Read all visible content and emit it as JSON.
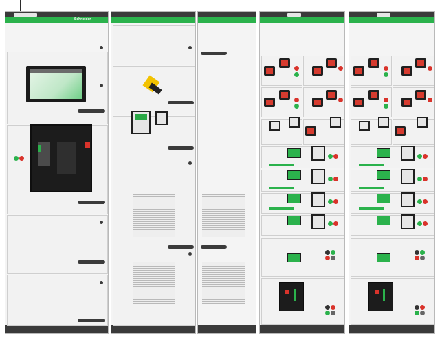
{
  "image": {
    "alt": "",
    "brand_text": "Schneider",
    "accent_color": "#2bb24c",
    "frame_color": "#3a3a3a",
    "panel_color": "#f4f4f4"
  }
}
